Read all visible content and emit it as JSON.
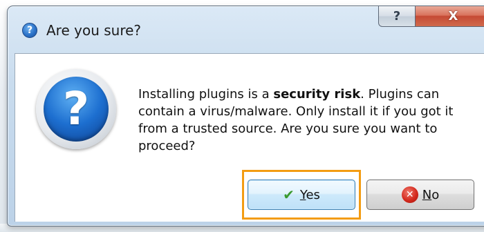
{
  "dialog": {
    "title": "Are you sure?",
    "title_icon": "question-icon",
    "caption": {
      "help_label": "?",
      "close_label": "X"
    },
    "message": {
      "before": "Installing plugins is a ",
      "emphasis": "security risk",
      "after": ". Plugins can contain a virus/malware. Only install it if you got it from a trusted source. Are you sure you want to proceed?"
    },
    "main_icon": "question-icon",
    "buttons": {
      "yes": {
        "mnemonic": "Y",
        "rest": "es",
        "icon": "checkmark-icon"
      },
      "no": {
        "mnemonic": "N",
        "rest": "o",
        "icon": "error-x-icon"
      }
    },
    "colors": {
      "focus_highlight": "#f39c12",
      "check_green": "#3a9a2f",
      "close_red": "#c54a34",
      "icon_blue": "#1d6fd0"
    }
  }
}
